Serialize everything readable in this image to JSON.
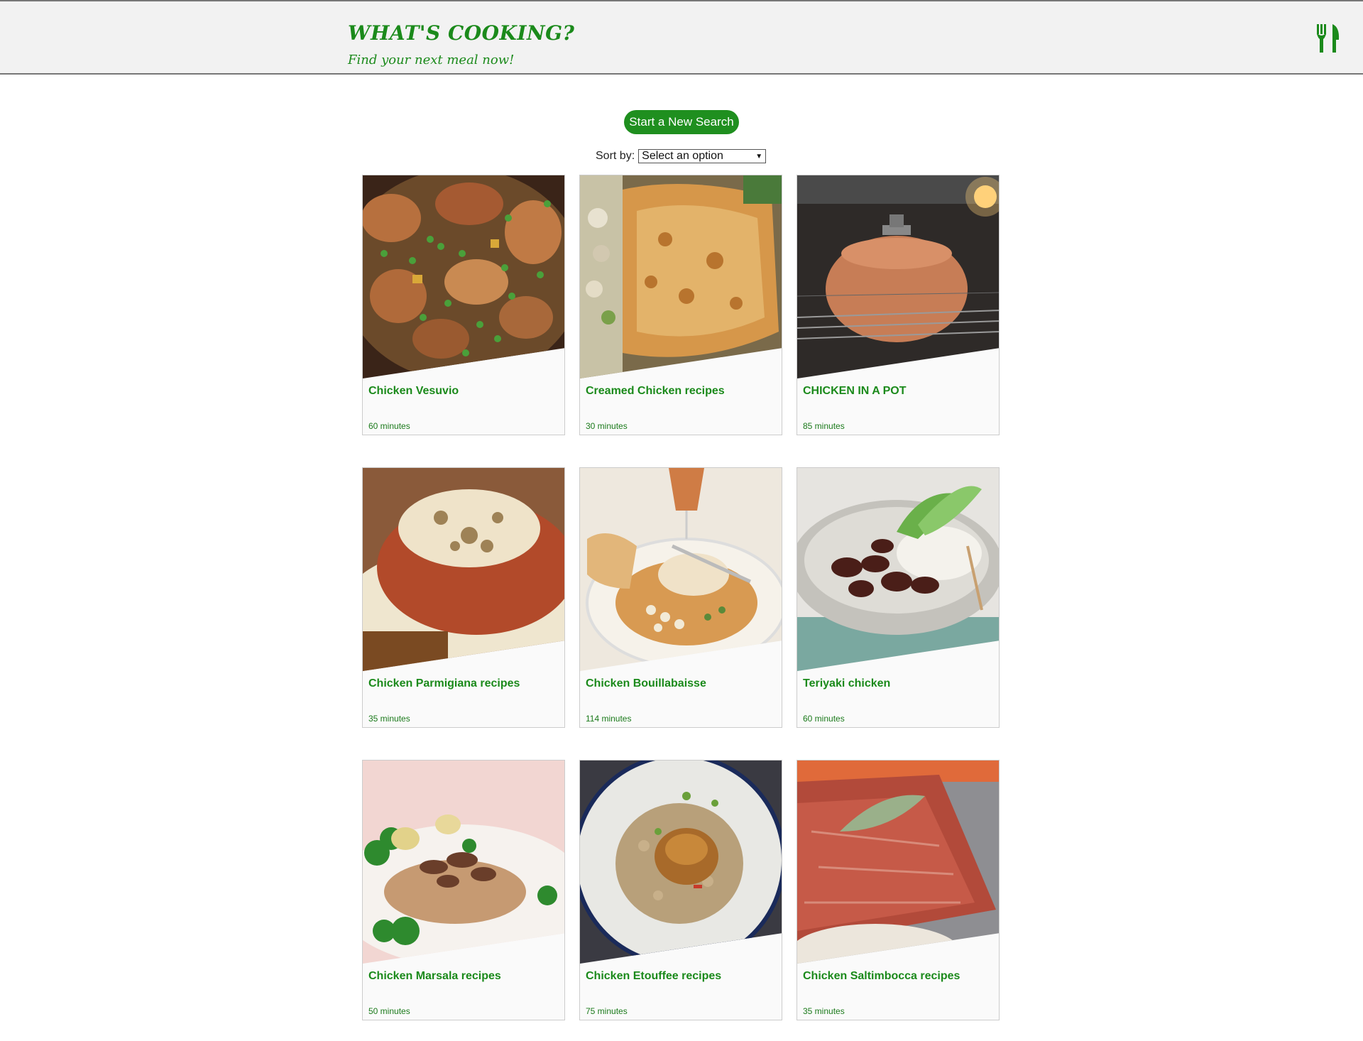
{
  "header": {
    "title": "WHAT'S COOKING?",
    "subtitle": "Find your next meal now!",
    "icon": "utensils-icon"
  },
  "controls": {
    "new_search_label": "Start a New Search",
    "sort_label": "Sort by:",
    "sort_selected": "Select an option"
  },
  "colors": {
    "brand_green": "#1b8a1b",
    "button_green": "#1f8f1f"
  },
  "recipes": [
    {
      "title": "Chicken Vesuvio",
      "time": "60 minutes",
      "photo": "braised chicken with peas"
    },
    {
      "title": "Creamed Chicken recipes",
      "time": "30 minutes",
      "photo": "chicken pot pie crust"
    },
    {
      "title": "CHICKEN IN A POT",
      "time": "85 minutes",
      "photo": "clay pot in oven"
    },
    {
      "title": "Chicken Parmigiana recipes",
      "time": "35 minutes",
      "photo": "chicken parmigiana plate"
    },
    {
      "title": "Chicken Bouillabaisse",
      "time": "114 minutes",
      "photo": "bouillabaisse with toast"
    },
    {
      "title": "Teriyaki chicken",
      "time": "60 minutes",
      "photo": "teriyaki chicken bowl"
    },
    {
      "title": "Chicken Marsala recipes",
      "time": "50 minutes",
      "photo": "chicken marsala with mushrooms"
    },
    {
      "title": "Chicken Etouffee recipes",
      "time": "75 minutes",
      "photo": "etouffee over rice"
    },
    {
      "title": "Chicken Saltimbocca recipes",
      "time": "35 minutes",
      "photo": "saltimbocca with sage"
    }
  ]
}
